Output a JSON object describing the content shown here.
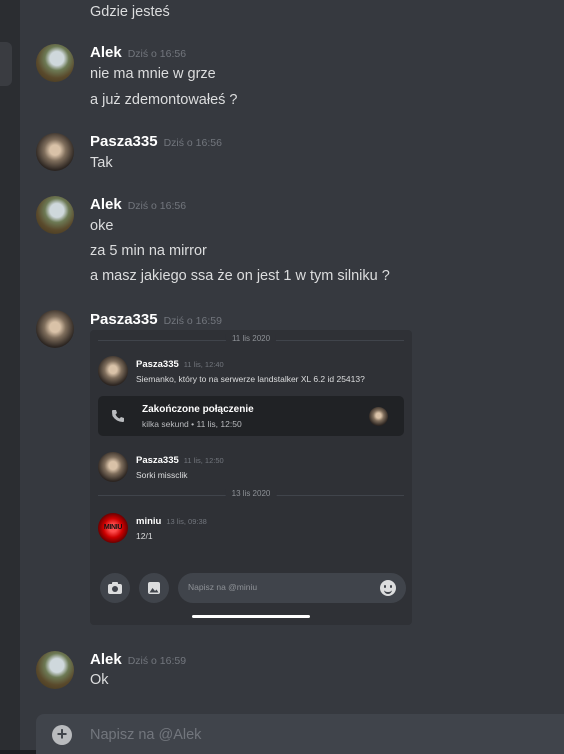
{
  "messages": {
    "m0": {
      "text": "Gdzie jesteś"
    },
    "m1": {
      "author": "Alek",
      "time": "Dziś o 16:56",
      "lines": [
        "nie ma mnie w grze",
        "a już zdemontowałeś ?"
      ]
    },
    "m2": {
      "author": "Pasza335",
      "time": "Dziś o 16:56",
      "lines": [
        "Tak"
      ]
    },
    "m3": {
      "author": "Alek",
      "time": "Dziś o 16:56",
      "lines": [
        "oke",
        "za 5 min na mirror",
        "a masz jakiego ssa że on jest 1 w tym silniku ?"
      ]
    },
    "m4": {
      "author": "Pasza335",
      "time": "Dziś o 16:59"
    },
    "m5": {
      "author": "Alek",
      "time": "Dziś o 16:59",
      "lines": [
        "Ok"
      ]
    }
  },
  "attachment": {
    "dividers": [
      "11 lis 2020",
      "13 lis 2020"
    ],
    "msgs": [
      {
        "author": "Pasza335",
        "time": "11 lis, 12:40",
        "text": "Siemanko, który to na serwerze landstalker XL 6.2 id 25413?"
      },
      {
        "author": "Pasza335",
        "time": "11 lis, 12:50",
        "text": "Sorki missclik"
      },
      {
        "author": "miniu",
        "time": "13 lis, 09:38",
        "text": "12/1"
      }
    ],
    "call": {
      "title": "Zakończone połączenie",
      "subtitle": "kilka sekund • 11 lis, 12:50"
    },
    "avatar_text": "MINIU",
    "input_placeholder": "Napisz na @miniu",
    "icons": [
      "camera-icon",
      "image-icon",
      "emoji-icon",
      "phone-call-icon"
    ]
  },
  "composer": {
    "placeholder": "Napisz na @Alek"
  },
  "colors": {
    "background": "#36393f",
    "author": "#ffffff",
    "timestamp": "#72767d",
    "input": "#40444b"
  }
}
